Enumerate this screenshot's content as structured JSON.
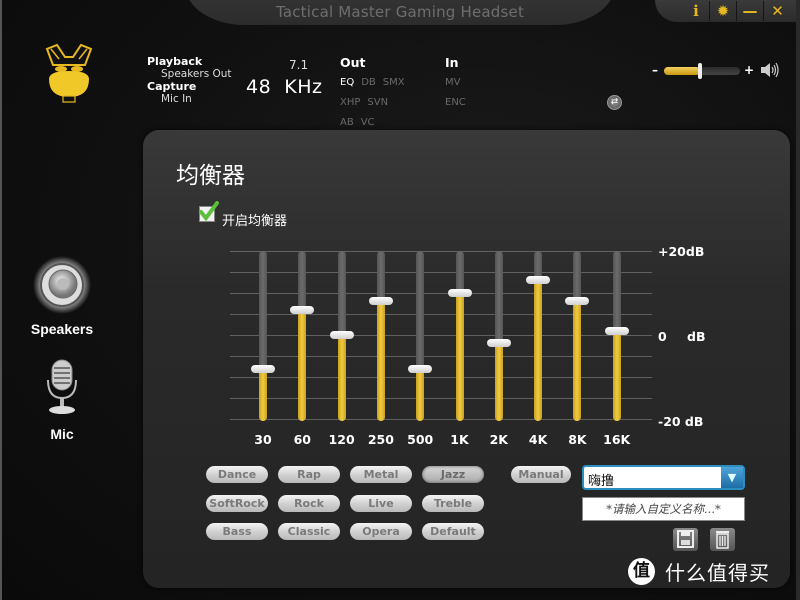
{
  "window": {
    "title": "Tactical Master Gaming Headset",
    "controls": {
      "info": "i",
      "settings": "✹",
      "minimize": "—",
      "close": "✕"
    }
  },
  "device": {
    "playback_label": "Playback",
    "playback_device": "Speakers Out",
    "capture_label": "Capture",
    "capture_device": "Mic In",
    "channels": "7.1",
    "sample_rate": "48  KHz"
  },
  "effects": {
    "out_title": "Out",
    "out_tags": [
      {
        "label": "EQ",
        "active": true
      },
      {
        "label": "DB",
        "active": false
      },
      {
        "label": "SMX",
        "active": false
      },
      {
        "label": "XHP",
        "active": false
      },
      {
        "label": "SVN",
        "active": false
      },
      {
        "label": "AB",
        "active": false
      },
      {
        "label": "VC",
        "active": false
      }
    ],
    "in_title": "In",
    "in_tags": [
      {
        "label": "MV",
        "active": false
      },
      {
        "label": "ENC",
        "active": false
      }
    ]
  },
  "volume": {
    "minus": "–",
    "plus": "+",
    "level_percent": 47
  },
  "nav": {
    "items": [
      {
        "label": "Speakers",
        "icon": "speaker-icon",
        "active": true
      },
      {
        "label": "Mic",
        "icon": "microphone-icon",
        "active": false
      }
    ]
  },
  "equalizer": {
    "title": "均衡器",
    "enable_label": "开启均衡器",
    "enabled": true,
    "db_labels": {
      "top": "+20dB",
      "mid_value": "0",
      "mid_unit": "dB",
      "bottom": "-20 dB"
    },
    "range_db": [
      -20,
      20
    ],
    "gridline_step_db": 5,
    "bands": [
      {
        "freq": "30",
        "gain_db": -8
      },
      {
        "freq": "60",
        "gain_db": 6
      },
      {
        "freq": "120",
        "gain_db": 0
      },
      {
        "freq": "250",
        "gain_db": 8
      },
      {
        "freq": "500",
        "gain_db": -8
      },
      {
        "freq": "1K",
        "gain_db": 10
      },
      {
        "freq": "2K",
        "gain_db": -2
      },
      {
        "freq": "4K",
        "gain_db": 13
      },
      {
        "freq": "8K",
        "gain_db": 8
      },
      {
        "freq": "16K",
        "gain_db": 1
      }
    ]
  },
  "presets": {
    "rows": [
      [
        "Dance",
        "Rap",
        "Metal",
        "Jazz"
      ],
      [
        "SoftRock",
        "Rock",
        "Live",
        "Treble"
      ],
      [
        "Bass",
        "Classic",
        "Opera",
        "Default"
      ]
    ],
    "selected": "Jazz",
    "manual_label": "Manual",
    "custom_selected": "嗨撸",
    "custom_name_placeholder": "*请输入自定义名称...*",
    "save_icon": "save-icon",
    "delete_icon": "trash-icon"
  },
  "watermark": {
    "badge": "值",
    "text": "什么值得买"
  },
  "colors": {
    "accent": "#e8b820",
    "bar_fill": "#f0cc40",
    "combo_border": "#2a8fc0"
  }
}
